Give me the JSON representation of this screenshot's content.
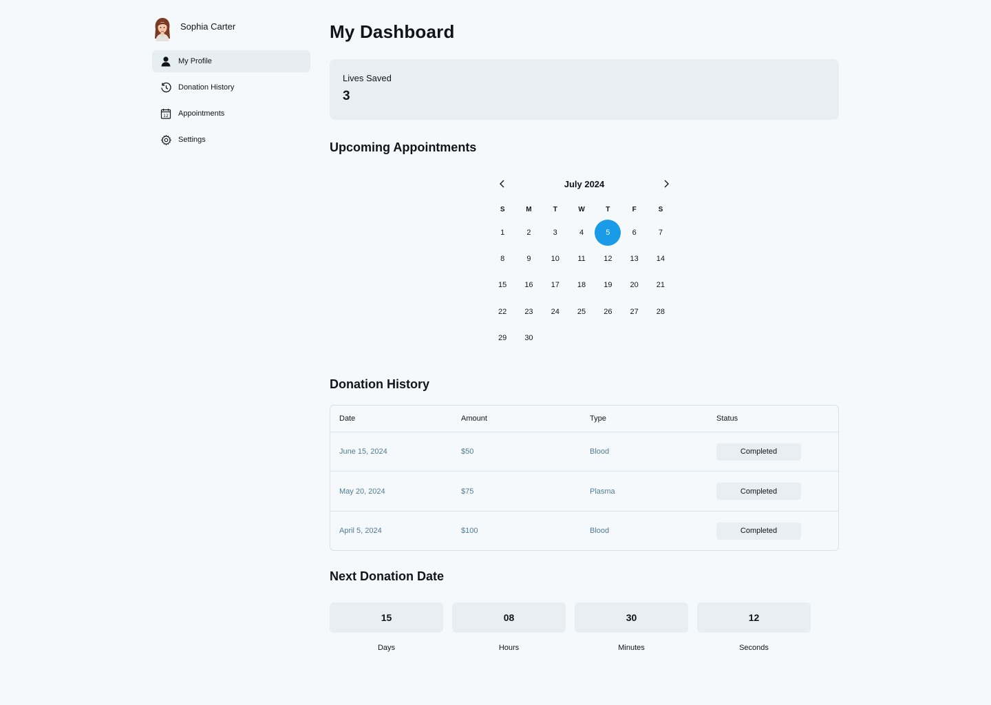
{
  "user": {
    "name": "Sophia Carter"
  },
  "sidebar": {
    "items": [
      {
        "label": "My Profile",
        "icon": "user-icon",
        "active": true
      },
      {
        "label": "Donation History",
        "icon": "history-icon",
        "active": false
      },
      {
        "label": "Appointments",
        "icon": "calendar-icon",
        "active": false
      },
      {
        "label": "Settings",
        "icon": "gear-icon",
        "active": false
      }
    ]
  },
  "page": {
    "title": "My Dashboard"
  },
  "stats": {
    "lives_saved_label": "Lives Saved",
    "lives_saved_value": "3"
  },
  "appointments": {
    "title": "Upcoming Appointments",
    "calendar": {
      "month": "July 2024",
      "weekdays": [
        "S",
        "M",
        "T",
        "W",
        "T",
        "F",
        "S"
      ],
      "first_weekday_index": 0,
      "days_in_month": 30,
      "selected_day": 5,
      "accent_color": "#1a9be8"
    }
  },
  "history": {
    "title": "Donation History",
    "columns": [
      "Date",
      "Amount",
      "Type",
      "Status"
    ],
    "rows": [
      {
        "date": "June 15, 2024",
        "amount": "$50",
        "type": "Blood",
        "status": "Completed"
      },
      {
        "date": "May 20, 2024",
        "amount": "$75",
        "type": "Plasma",
        "status": "Completed"
      },
      {
        "date": "April 5, 2024",
        "amount": "$100",
        "type": "Blood",
        "status": "Completed"
      }
    ]
  },
  "next_donation": {
    "title": "Next Donation Date",
    "units": [
      {
        "value": "15",
        "label": "Days"
      },
      {
        "value": "08",
        "label": "Hours"
      },
      {
        "value": "30",
        "label": "Minutes"
      },
      {
        "value": "12",
        "label": "Seconds"
      }
    ]
  }
}
